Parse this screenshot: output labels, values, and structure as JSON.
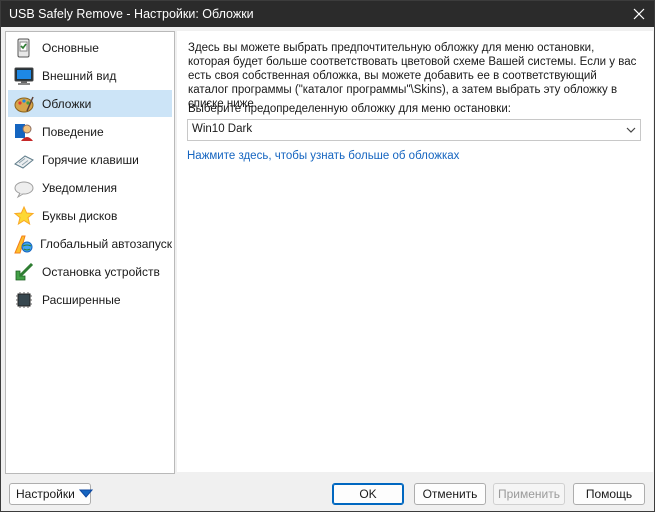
{
  "window": {
    "title": "USB Safely Remove - Настройки: Обложки"
  },
  "sidebar": {
    "items": [
      {
        "label": "Основные",
        "icon": "phone-check-icon"
      },
      {
        "label": "Внешний вид",
        "icon": "monitor-icon"
      },
      {
        "label": "Обложки",
        "icon": "palette-icon",
        "selected": true
      },
      {
        "label": "Поведение",
        "icon": "person-icon"
      },
      {
        "label": "Горячие клавиши",
        "icon": "keyboard-icon"
      },
      {
        "label": "Уведомления",
        "icon": "cloud-icon"
      },
      {
        "label": "Буквы дисков",
        "icon": "star-icon"
      },
      {
        "label": "Глобальный автозапуск",
        "icon": "globe-icon"
      },
      {
        "label": "Остановка устройств",
        "icon": "green-arrow-icon"
      },
      {
        "label": "Расширенные",
        "icon": "chip-icon"
      }
    ]
  },
  "content": {
    "description": "Здесь вы можете выбрать предпочтительную обложку для меню остановки, которая будет больше соответствовать цветовой схеме Вашей системы. Если у вас есть своя собственная обложка, вы можете добавить ее в соответствующий каталог программы (\"каталог программы\"\\Skins), а затем выбрать эту обложку в списке ниже.",
    "combo_label": "Выберите предопределенную обложку для меню остановки:",
    "combo_value": "Win10 Dark",
    "link": "Нажмите здесь, чтобы узнать больше об обложках"
  },
  "footer": {
    "settings_label": "Настройки",
    "ok_label": "OK",
    "cancel_label": "Отменить",
    "apply_label": "Применить",
    "help_label": "Помощь"
  },
  "colors": {
    "titlebar": "#2b2b2b",
    "selection": "#cce4f7",
    "link": "#1565c0",
    "accent": "#0067c0"
  }
}
